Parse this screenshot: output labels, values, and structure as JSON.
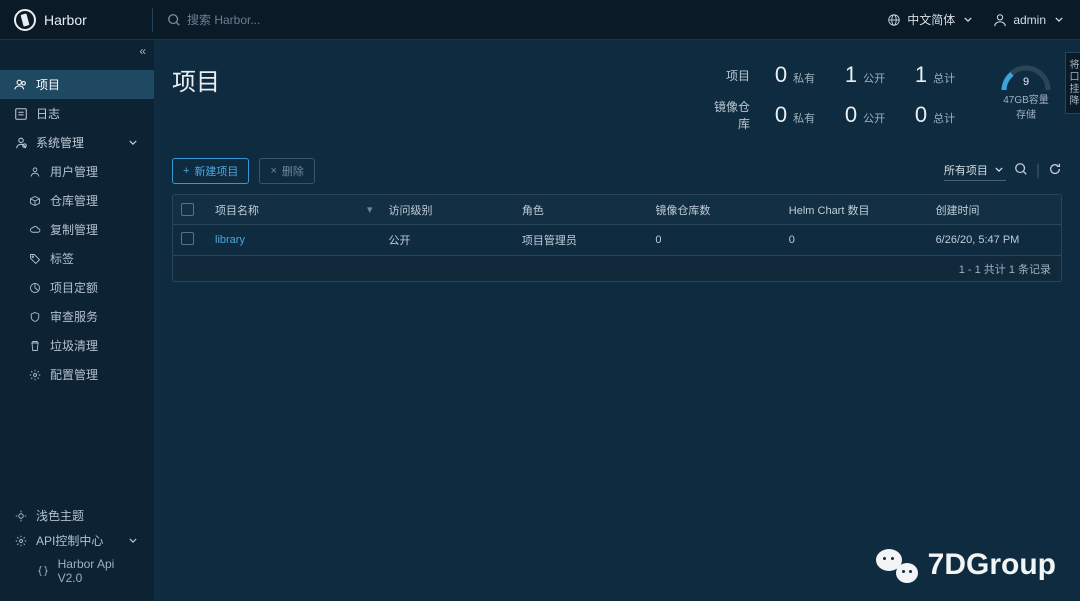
{
  "brand": "Harbor",
  "search": {
    "placeholder": "搜索 Harbor..."
  },
  "language": "中文简体",
  "user": "admin",
  "sideTab": "将口挂降",
  "sidebar": {
    "items": [
      {
        "icon": "user-group",
        "label": "项目",
        "active": true
      },
      {
        "icon": "list",
        "label": "日志"
      },
      {
        "icon": "admin",
        "label": "系统管理",
        "expand": true
      }
    ],
    "admin_children": [
      {
        "icon": "users",
        "label": "用户管理"
      },
      {
        "icon": "cube",
        "label": "仓库管理"
      },
      {
        "icon": "cloud",
        "label": "复制管理"
      },
      {
        "icon": "tag",
        "label": "标签"
      },
      {
        "icon": "quota",
        "label": "项目定额"
      },
      {
        "icon": "shield",
        "label": "审查服务"
      },
      {
        "icon": "trash",
        "label": "垃圾清理"
      },
      {
        "icon": "gear",
        "label": "配置管理"
      }
    ],
    "footer": {
      "theme": {
        "label": "浅色主题"
      },
      "api": {
        "label": "API控制中心"
      },
      "api_child": {
        "label": "Harbor Api V2.0"
      }
    }
  },
  "page": {
    "title": "项目"
  },
  "stats": {
    "row1_label": "项目",
    "row2_label": "镜像仓库",
    "private_label": "私有",
    "public_label": "公开",
    "total_label": "总计",
    "projects": {
      "private": "0",
      "public": "1",
      "total": "1"
    },
    "repos": {
      "private": "0",
      "public": "0",
      "total": "0"
    },
    "gauge": {
      "value": "9",
      "capacity": "47GB容量",
      "storage": "存储"
    }
  },
  "toolbar": {
    "new_project": "新建项目",
    "delete": "删除",
    "filter": "所有项目"
  },
  "table": {
    "headers": {
      "name": "项目名称",
      "access": "访问级别",
      "role": "角色",
      "repos": "镜像仓库数",
      "charts": "Helm Chart 数目",
      "created": "创建时间"
    },
    "rows": [
      {
        "name": "library",
        "access": "公开",
        "role": "项目管理员",
        "repos": "0",
        "charts": "0",
        "created": "6/26/20, 5:47 PM"
      }
    ],
    "footer": "1 - 1 共计 1 条记录"
  },
  "watermark": "7DGroup"
}
